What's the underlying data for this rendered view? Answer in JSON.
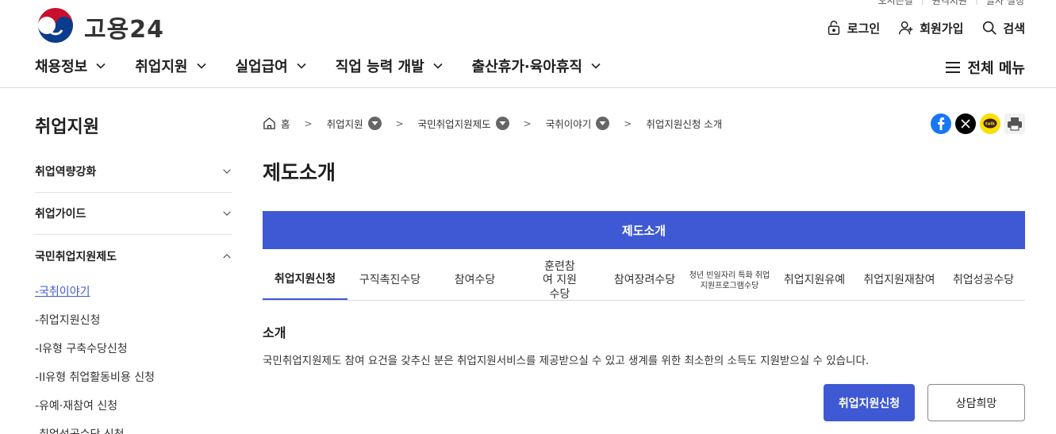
{
  "header": {
    "util_links": [
      "오시는길",
      "원격지원",
      "글자 설정"
    ],
    "logo_text": "고용24",
    "actions": {
      "login": "로그인",
      "signup": "회원가입",
      "search": "검색"
    },
    "gnb": [
      "채용정보",
      "취업지원",
      "실업급여",
      "직업 능력 개발",
      "출산휴가·육아휴직"
    ],
    "all_menu": "전체 메뉴"
  },
  "sidebar": {
    "title": "취업지원",
    "items": [
      {
        "label": "취업역량강화"
      },
      {
        "label": "취업가이드"
      },
      {
        "label": "국민취업지원제도"
      }
    ],
    "sub_items": [
      "-국취이야기",
      "-취업지원신청",
      "-I유형 구축수당신청",
      "-II유형 취업활동비용 신청",
      "-유예·재참여 신청",
      "-취업성공수당 신청"
    ]
  },
  "breadcrumb": {
    "home": "홈",
    "items": [
      "취업지원",
      "국민취업지원제도",
      "국취이야기",
      "취업지원신청 소개"
    ]
  },
  "share": {
    "kakao_label": "talk"
  },
  "main": {
    "page_title": "제도소개",
    "tab_label": "제도소개",
    "subtabs": [
      "취업지원신청",
      "구직촉진수당",
      "참여수당",
      "훈련참여 지원수당",
      "참여장려수당",
      "청년 빈일자리 특화 취업지원프로그램수당",
      "취업지원유예",
      "취업지원재참여",
      "취업성공수당"
    ],
    "section_title": "소개",
    "section_desc": "국민취업지원제도 참여 요건을 갖추신 분은 취업지원서비스를 제공받으실 수 있고 생계를 위한 최소한의 소득도 지원받으실 수 있습니다.",
    "primary_button": "취업지원신청",
    "secondary_button": "상담희망"
  },
  "colors": {
    "accent": "#3e59d3",
    "facebook": "#1877f2",
    "x": "#000000",
    "kakao": "#f9e000"
  }
}
